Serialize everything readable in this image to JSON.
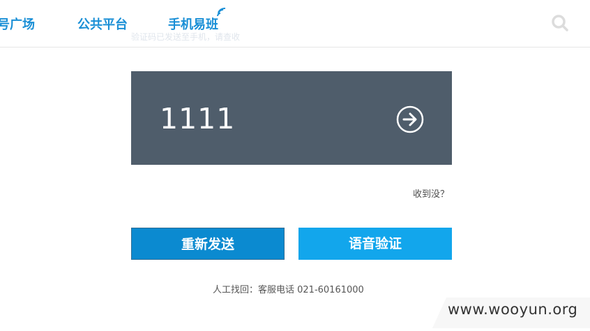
{
  "nav": {
    "items": [
      {
        "label": "号广场"
      },
      {
        "label": "公共平台"
      },
      {
        "label": "手机易班"
      }
    ],
    "search_icon": "search-icon",
    "wifi_icon": "wifi-signal-icon",
    "accent_color": "#1a8fd6"
  },
  "ghost_hint": "验证码已发送至手机，请查收",
  "verification": {
    "code_value": "1111",
    "submit_icon": "arrow-right-circle-icon",
    "panel_color": "#4f5d6b"
  },
  "received_link": "收到没？",
  "buttons": {
    "resend_label": "重新发送",
    "voice_label": "语音验证",
    "resend_color": "#0b8ad0",
    "voice_color": "#12a6ec"
  },
  "manual_recovery": "人工找回：客服电话 021-60161000",
  "watermark": "www.wooyun.org"
}
